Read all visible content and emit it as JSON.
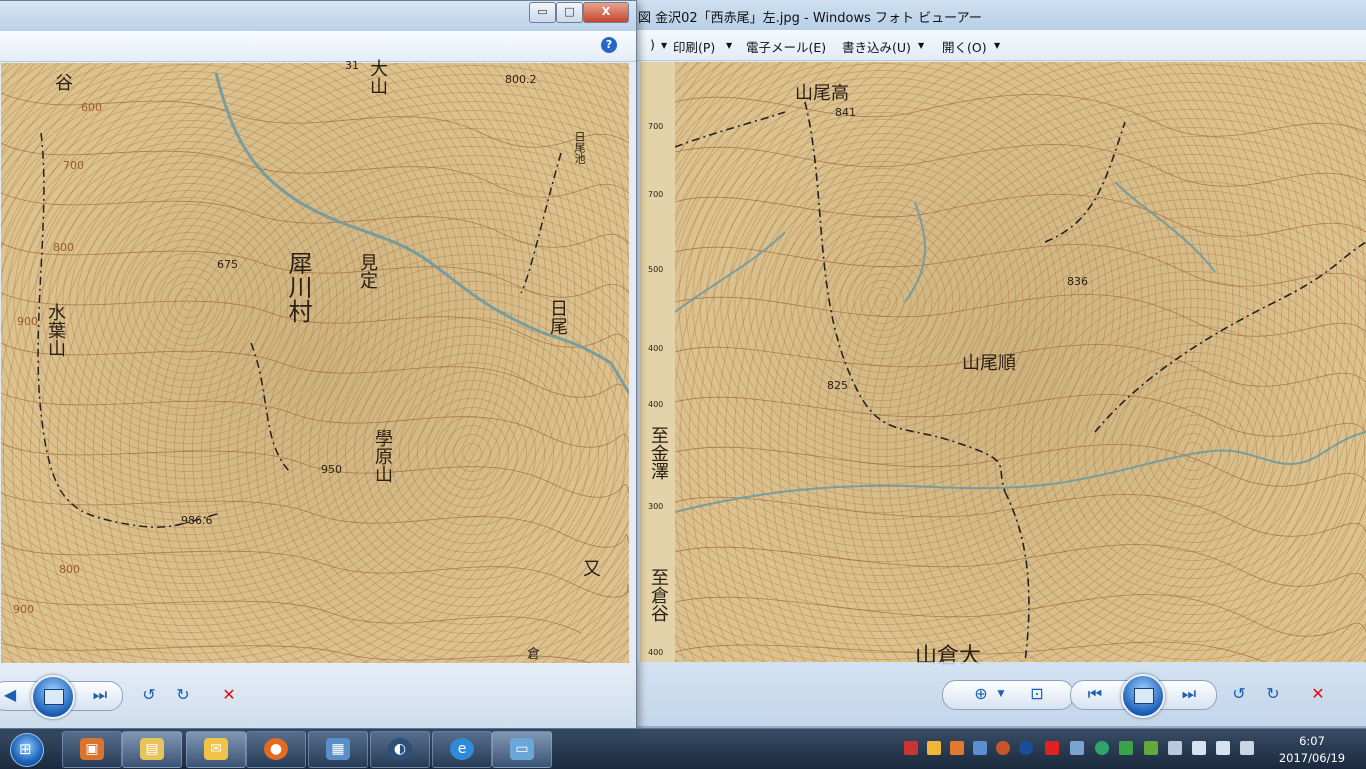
{
  "right_window": {
    "title": "図 金沢02「西赤尾」左.jpg - Windows フォト ビューアー",
    "menu": {
      "file_partial": ")",
      "print": "印刷(P)",
      "email": "電子メール(E)",
      "burn": "書き込み(U)",
      "open": "開く(O)"
    },
    "map_labels": {
      "takaoyama": "山尾高",
      "takaoyama_elev": "841",
      "junoyama": "山尾順",
      "peak836": "836",
      "peak825": "825",
      "to_kanazawa": "至金澤",
      "to_kuratani": "至倉谷",
      "okurayama": "山倉大",
      "margin_ticks": [
        "700",
        "700",
        "500",
        "400",
        "400",
        "300",
        "400"
      ]
    },
    "controls": [
      "zoom",
      "actual-size",
      "previous",
      "slideshow",
      "next",
      "rotate-left",
      "rotate-right",
      "delete"
    ]
  },
  "left_window": {
    "buttons": {
      "minimize": "▭",
      "maximize": "□",
      "close": "X"
    },
    "help": "?",
    "map_labels": {
      "oyama": "大山",
      "peak800": "800.2",
      "hio_ike": "日尾池",
      "mimisada": "見定",
      "sai_kawa_mura": "犀川村",
      "mizuhayama": "水葉山",
      "hio": "日尾",
      "gakuhara": "學原山",
      "peak675": "675",
      "peak950": "950",
      "peak986": "986.6",
      "mata": "又",
      "kura": "倉",
      "tani": "谷",
      "num31": "31",
      "contours": [
        "600",
        "700",
        "800",
        "900",
        "800",
        "900"
      ]
    }
  },
  "taskbar": {
    "clock_time": "6:07",
    "clock_date": "2017/06/19",
    "start_glyph": "⊞"
  },
  "colors": {
    "map_base": "#dcc28e",
    "contour": "#a0643a",
    "river": "#6f9a9e",
    "titlebar": "#c8dbee"
  }
}
